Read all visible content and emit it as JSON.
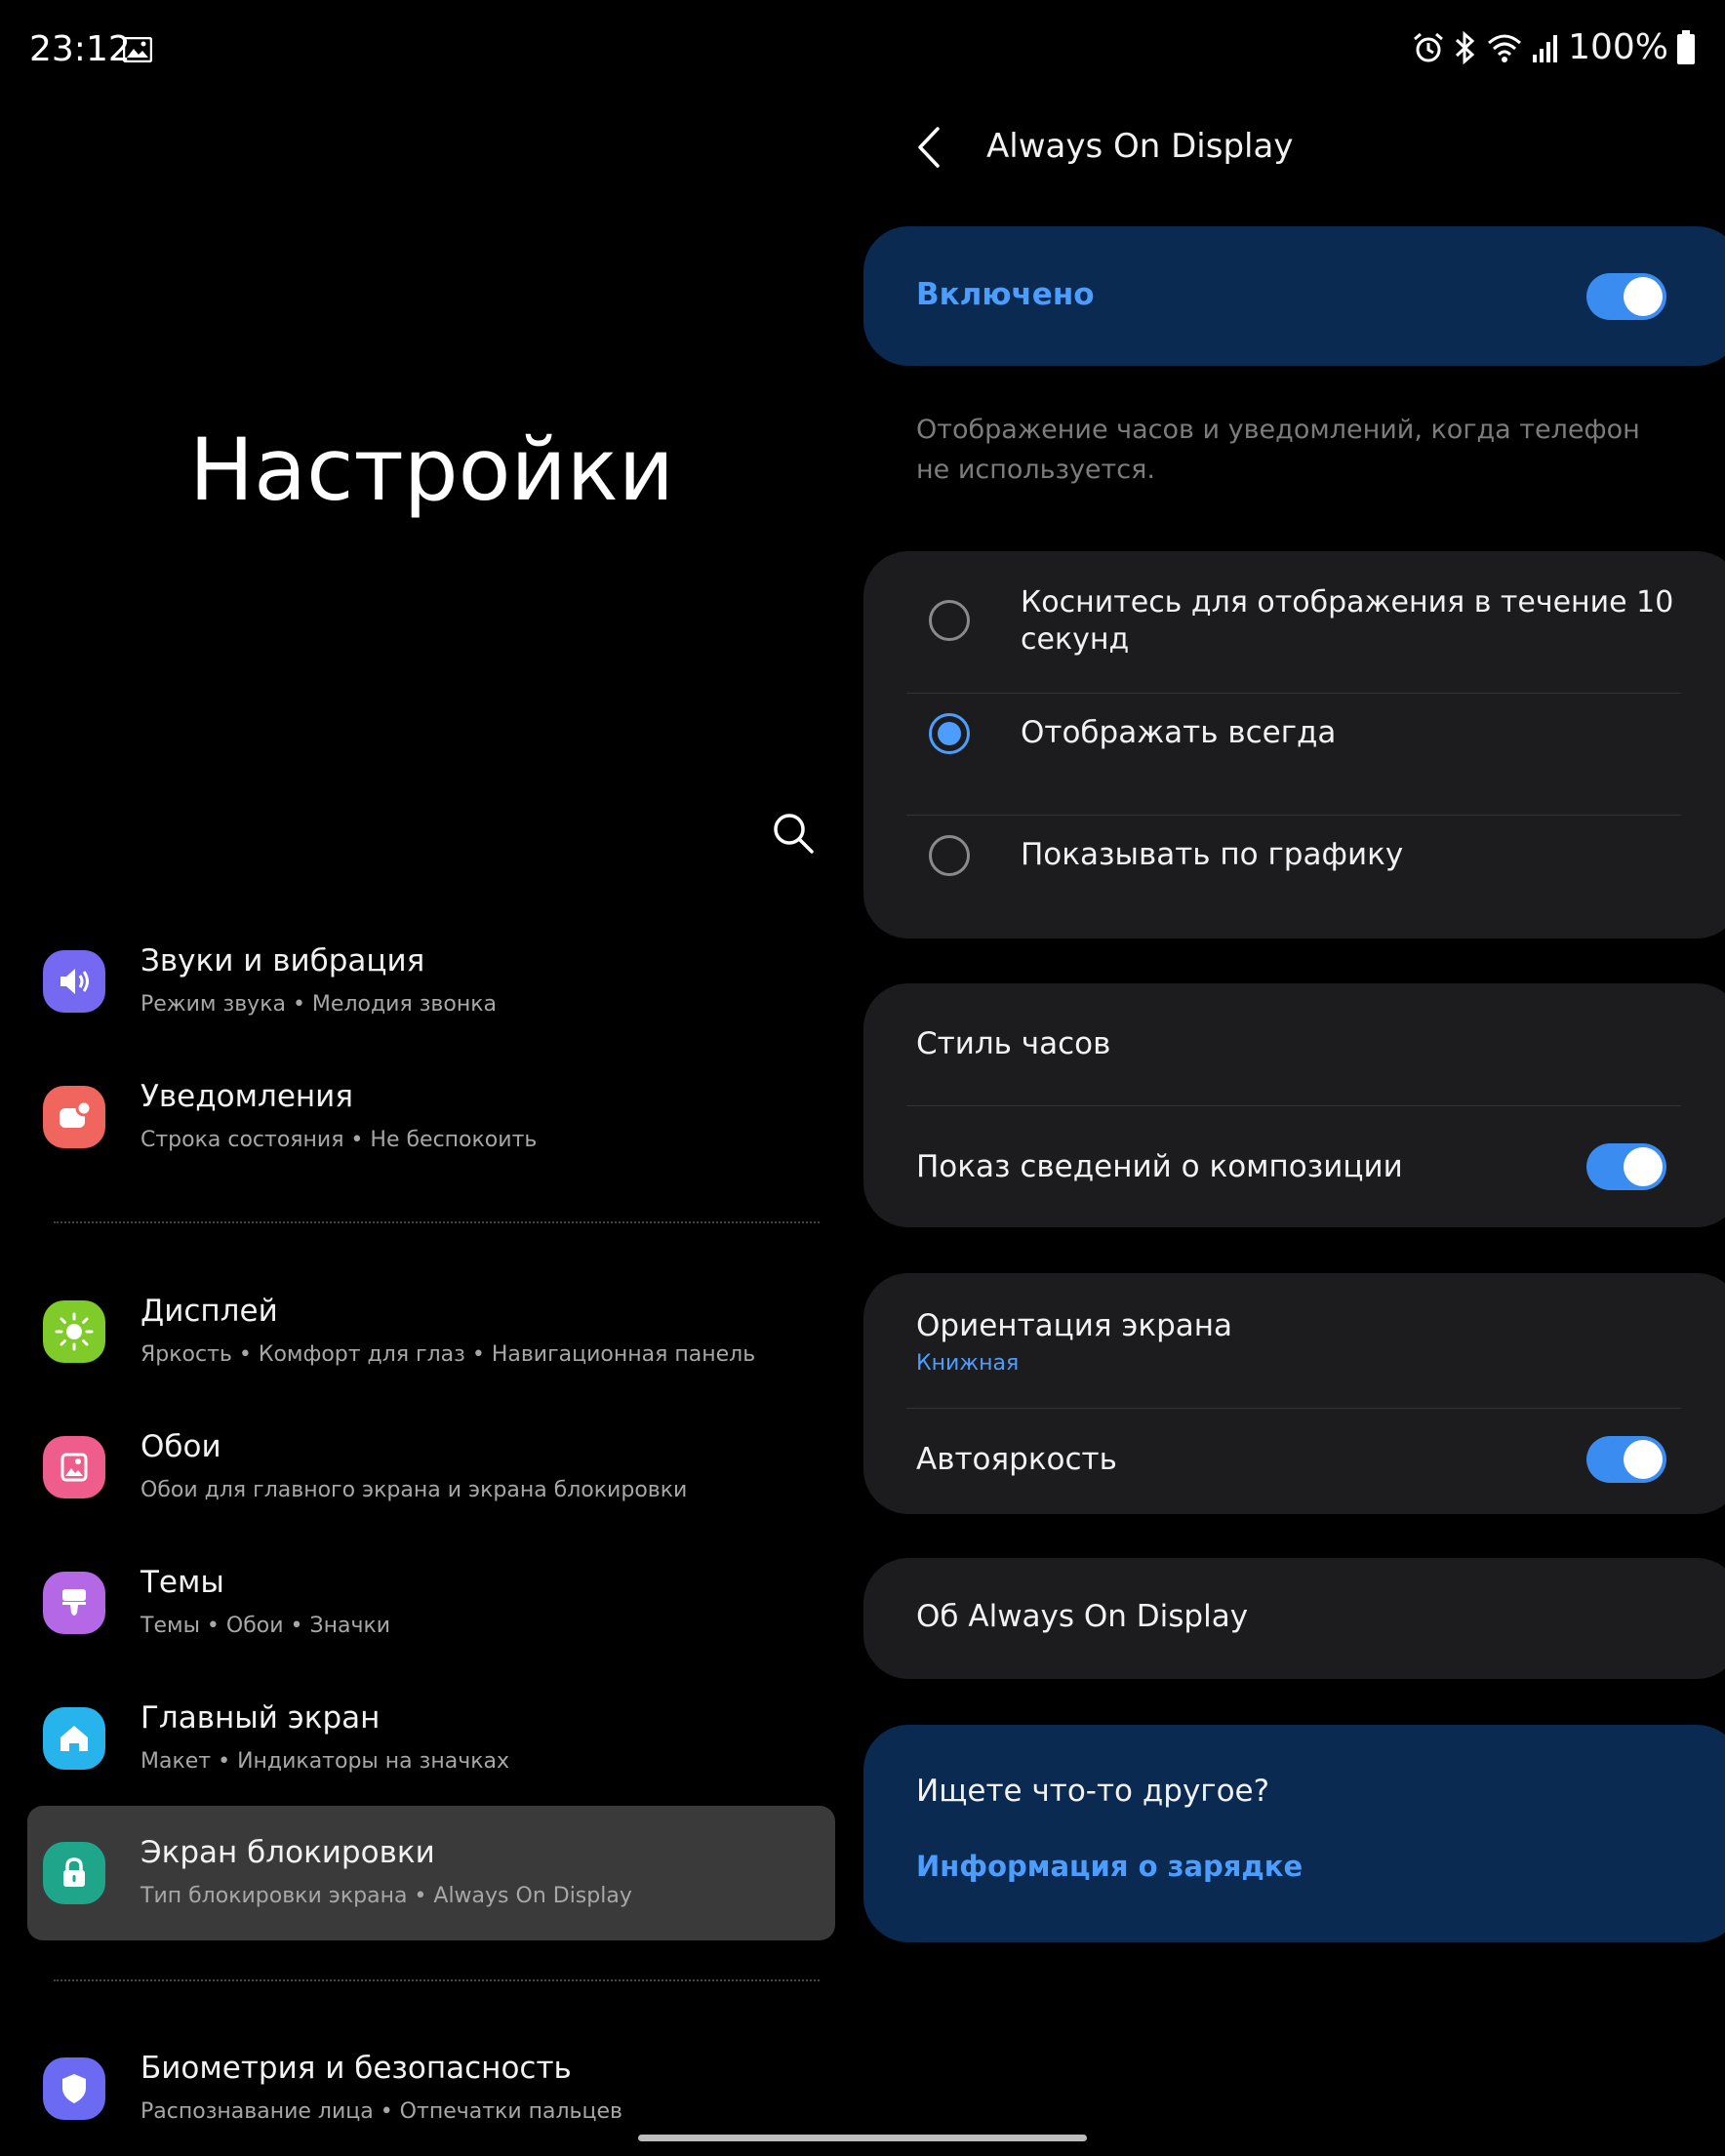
{
  "status_bar": {
    "time": "23:12",
    "battery": "100%"
  },
  "left": {
    "title": "Настройки",
    "items": [
      {
        "title": "Звуки и вибрация",
        "subtitle": "Режим звука  •  Мелодия звонка",
        "color": "#7469f0"
      },
      {
        "title": "Уведомления",
        "subtitle": "Строка состояния  •  Не беспокоить",
        "color": "#f0665e"
      },
      {
        "title": "Дисплей",
        "subtitle": "Яркость  •  Комфорт для глаз  •  Навигационная панель",
        "color": "#7ecb2a"
      },
      {
        "title": "Обои",
        "subtitle": "Обои для главного экрана и экрана блокировки",
        "color": "#ef5d8c"
      },
      {
        "title": "Темы",
        "subtitle": "Темы  •  Обои  •  Значки",
        "color": "#b568e6"
      },
      {
        "title": "Главный экран",
        "subtitle": "Макет  •  Индикаторы на значках",
        "color": "#27b3ec"
      },
      {
        "title": "Экран блокировки",
        "subtitle": "Тип блокировки экрана  •  Always On Display",
        "color": "#1fa58a"
      },
      {
        "title": "Биометрия и безопасность",
        "subtitle": "Распознавание лица  •  Отпечатки пальцев",
        "color": "#6a6af2"
      }
    ]
  },
  "right": {
    "title": "Always On Display",
    "master": {
      "label": "Включено",
      "enabled": true
    },
    "description": "Отображение часов и уведомлений, когда телефон не используется.",
    "modes": [
      {
        "label": "Коснитесь для отображения в течение 10 секунд",
        "selected": false
      },
      {
        "label": "Отображать всегда",
        "selected": true
      },
      {
        "label": "Показывать по графику",
        "selected": false
      }
    ],
    "clock_style": "Стиль часов",
    "music_info": {
      "label": "Показ сведений о композиции",
      "enabled": true
    },
    "orientation": {
      "label": "Ориентация экрана",
      "value": "Книжная"
    },
    "auto_brightness": {
      "label": "Автояркость",
      "enabled": true
    },
    "about": "Об Always On Display",
    "help": {
      "question": "Ищете что-то другое?",
      "link": "Информация о зарядке"
    }
  },
  "accent": "#3b8cf1"
}
